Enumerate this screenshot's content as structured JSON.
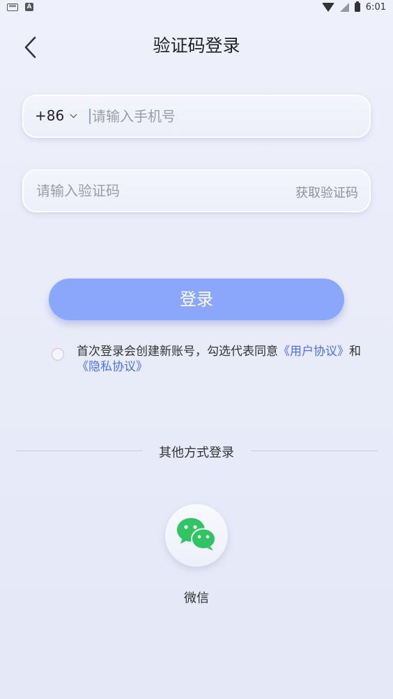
{
  "status_bar": {
    "time": "6:01"
  },
  "header": {
    "title": "验证码登录"
  },
  "phone_field": {
    "country_code": "+86",
    "placeholder": "请输入手机号"
  },
  "code_field": {
    "placeholder": "请输入验证码",
    "get_code_label": "获取验证码"
  },
  "login_button": {
    "label": "登录",
    "color": "#8ba7fb"
  },
  "agreement": {
    "text": "首次登录会创建新账号，勾选代表同意",
    "user_agreement": "《用户协议》",
    "and": "和",
    "privacy_policy": "《隐私协议》",
    "checked": false,
    "link_color": "#4a6ff0"
  },
  "other_login": {
    "title": "其他方式登录",
    "wechat_label": "微信",
    "wechat_icon": "wechat-icon"
  }
}
